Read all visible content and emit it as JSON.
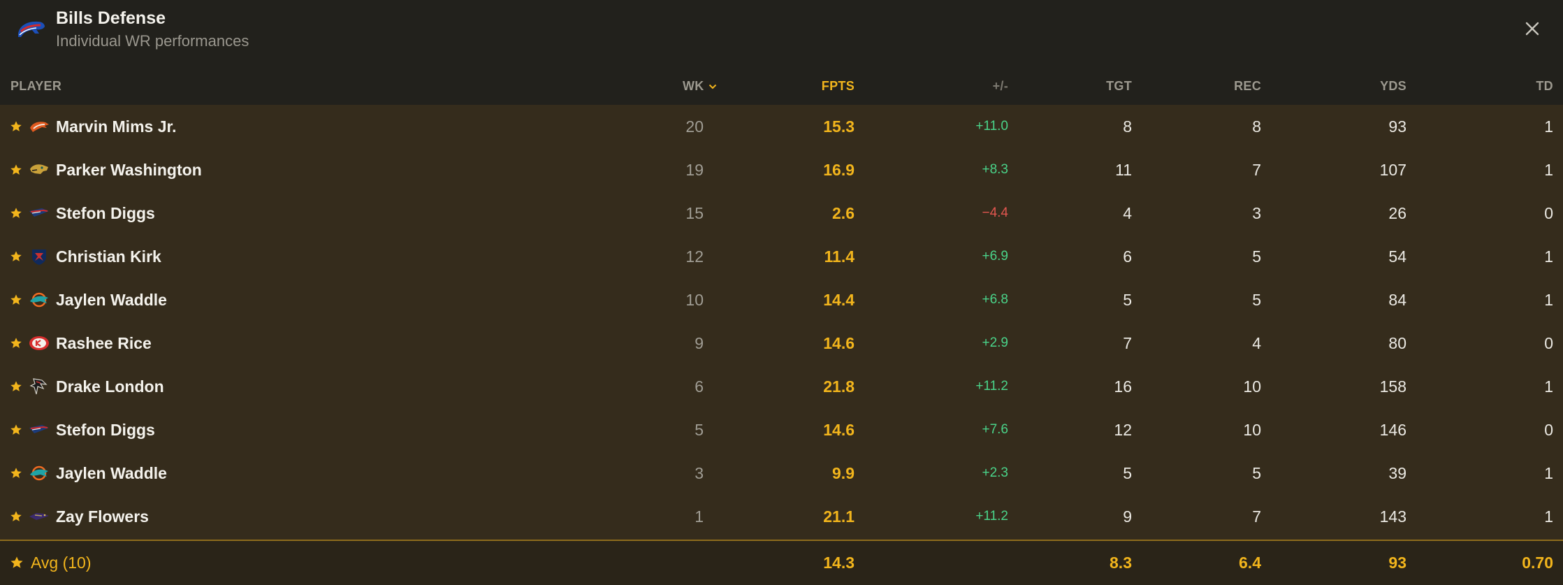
{
  "header": {
    "title": "Bills Defense",
    "subtitle": "Individual WR performances",
    "team_logo_icon": "bills-logo-icon",
    "close_icon": "close-icon"
  },
  "columns": {
    "player": "PLAYER",
    "wk": "WK",
    "fpts": "FPTS",
    "plus_minus": "+/-",
    "tgt": "TGT",
    "rec": "REC",
    "yds": "YDS",
    "td": "TD"
  },
  "rows": [
    {
      "name": "Marvin Mims Jr.",
      "team_icon": "broncos-logo-icon",
      "wk": "20",
      "fpts": "15.3",
      "pm": "+11.0",
      "tgt": "8",
      "rec": "8",
      "yds": "93",
      "td": "1"
    },
    {
      "name": "Parker Washington",
      "team_icon": "jaguars-logo-icon",
      "wk": "19",
      "fpts": "16.9",
      "pm": "+8.3",
      "tgt": "11",
      "rec": "7",
      "yds": "107",
      "td": "1"
    },
    {
      "name": "Stefon Diggs",
      "team_icon": "patriots-logo-icon",
      "wk": "15",
      "fpts": "2.6",
      "pm": "-4.4",
      "tgt": "4",
      "rec": "3",
      "yds": "26",
      "td": "0"
    },
    {
      "name": "Christian Kirk",
      "team_icon": "texans-logo-icon",
      "wk": "12",
      "fpts": "11.4",
      "pm": "+6.9",
      "tgt": "6",
      "rec": "5",
      "yds": "54",
      "td": "1"
    },
    {
      "name": "Jaylen Waddle",
      "team_icon": "dolphins-logo-icon",
      "wk": "10",
      "fpts": "14.4",
      "pm": "+6.8",
      "tgt": "5",
      "rec": "5",
      "yds": "84",
      "td": "1"
    },
    {
      "name": "Rashee Rice",
      "team_icon": "chiefs-logo-icon",
      "wk": "9",
      "fpts": "14.6",
      "pm": "+2.9",
      "tgt": "7",
      "rec": "4",
      "yds": "80",
      "td": "0"
    },
    {
      "name": "Drake London",
      "team_icon": "falcons-logo-icon",
      "wk": "6",
      "fpts": "21.8",
      "pm": "+11.2",
      "tgt": "16",
      "rec": "10",
      "yds": "158",
      "td": "1"
    },
    {
      "name": "Stefon Diggs",
      "team_icon": "patriots-logo-icon",
      "wk": "5",
      "fpts": "14.6",
      "pm": "+7.6",
      "tgt": "12",
      "rec": "10",
      "yds": "146",
      "td": "0"
    },
    {
      "name": "Jaylen Waddle",
      "team_icon": "dolphins-logo-icon",
      "wk": "3",
      "fpts": "9.9",
      "pm": "+2.3",
      "tgt": "5",
      "rec": "5",
      "yds": "39",
      "td": "1"
    },
    {
      "name": "Zay Flowers",
      "team_icon": "ravens-logo-icon",
      "wk": "1",
      "fpts": "21.1",
      "pm": "+11.2",
      "tgt": "9",
      "rec": "7",
      "yds": "143",
      "td": "1"
    }
  ],
  "footer": {
    "label": "Avg (10)",
    "fpts": "14.3",
    "tgt": "8.3",
    "rec": "6.4",
    "yds": "93",
    "td": "0.70"
  },
  "colors": {
    "accent_gold": "#f2b51c",
    "positive": "#4ad48a",
    "negative": "#e2564f"
  }
}
